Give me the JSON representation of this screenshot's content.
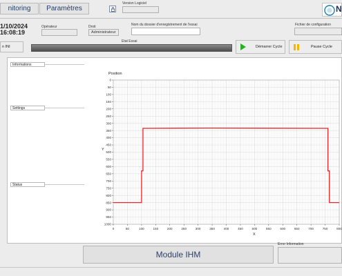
{
  "tabs": [
    {
      "label": "nitoring"
    },
    {
      "label": "Paramètres"
    }
  ],
  "header": {
    "version_label": "Version Logiciel",
    "version_value": "",
    "date": "1/10/2024",
    "time": "16:08:19",
    "operator_label": "Opérateur",
    "operator_value": "",
    "rights_label": "Droit",
    "rights_value": "Administrateur",
    "folder_label": "Nom du dossier d'enregistrement de l'essai",
    "folder_value": "",
    "config_label": "Fichier de configuration",
    "config_value": "",
    "logo_text": "N"
  },
  "toolbar": {
    "ini_label": "n INI",
    "state_label": "Etat Essai",
    "start_label": "Démarrer Cycle",
    "pause_label": "Pause Cycle"
  },
  "sections": {
    "info": "Informations",
    "settings": "Settings",
    "status": "Status"
  },
  "footer": {
    "module_label": "Module IHM",
    "error_label": "Error Information"
  },
  "colors": {
    "line": "#e8262a",
    "start_icon": "#26b026",
    "pause_icon": "#f2b800"
  },
  "chart_data": {
    "type": "line",
    "title": "Position",
    "xlabel": "X",
    "ylabel": "Y",
    "xlim": [
      0,
      800
    ],
    "ylim": [
      1000,
      0
    ],
    "y_inverted": true,
    "x_ticks": [
      0,
      50,
      100,
      150,
      200,
      250,
      300,
      350,
      400,
      450,
      500,
      550,
      600,
      650,
      700,
      750,
      800
    ],
    "y_ticks": [
      0,
      50,
      100,
      150,
      200,
      250,
      300,
      350,
      400,
      450,
      500,
      550,
      600,
      650,
      700,
      750,
      800,
      850,
      900,
      950,
      1000
    ],
    "grid": true,
    "series": [
      {
        "x": [
          0,
          100,
          100,
          105,
          105,
          340,
          760,
          760,
          765,
          765,
          800
        ],
        "y": [
          850,
          850,
          630,
          630,
          335,
          333,
          335,
          630,
          630,
          850,
          850
        ]
      }
    ]
  }
}
